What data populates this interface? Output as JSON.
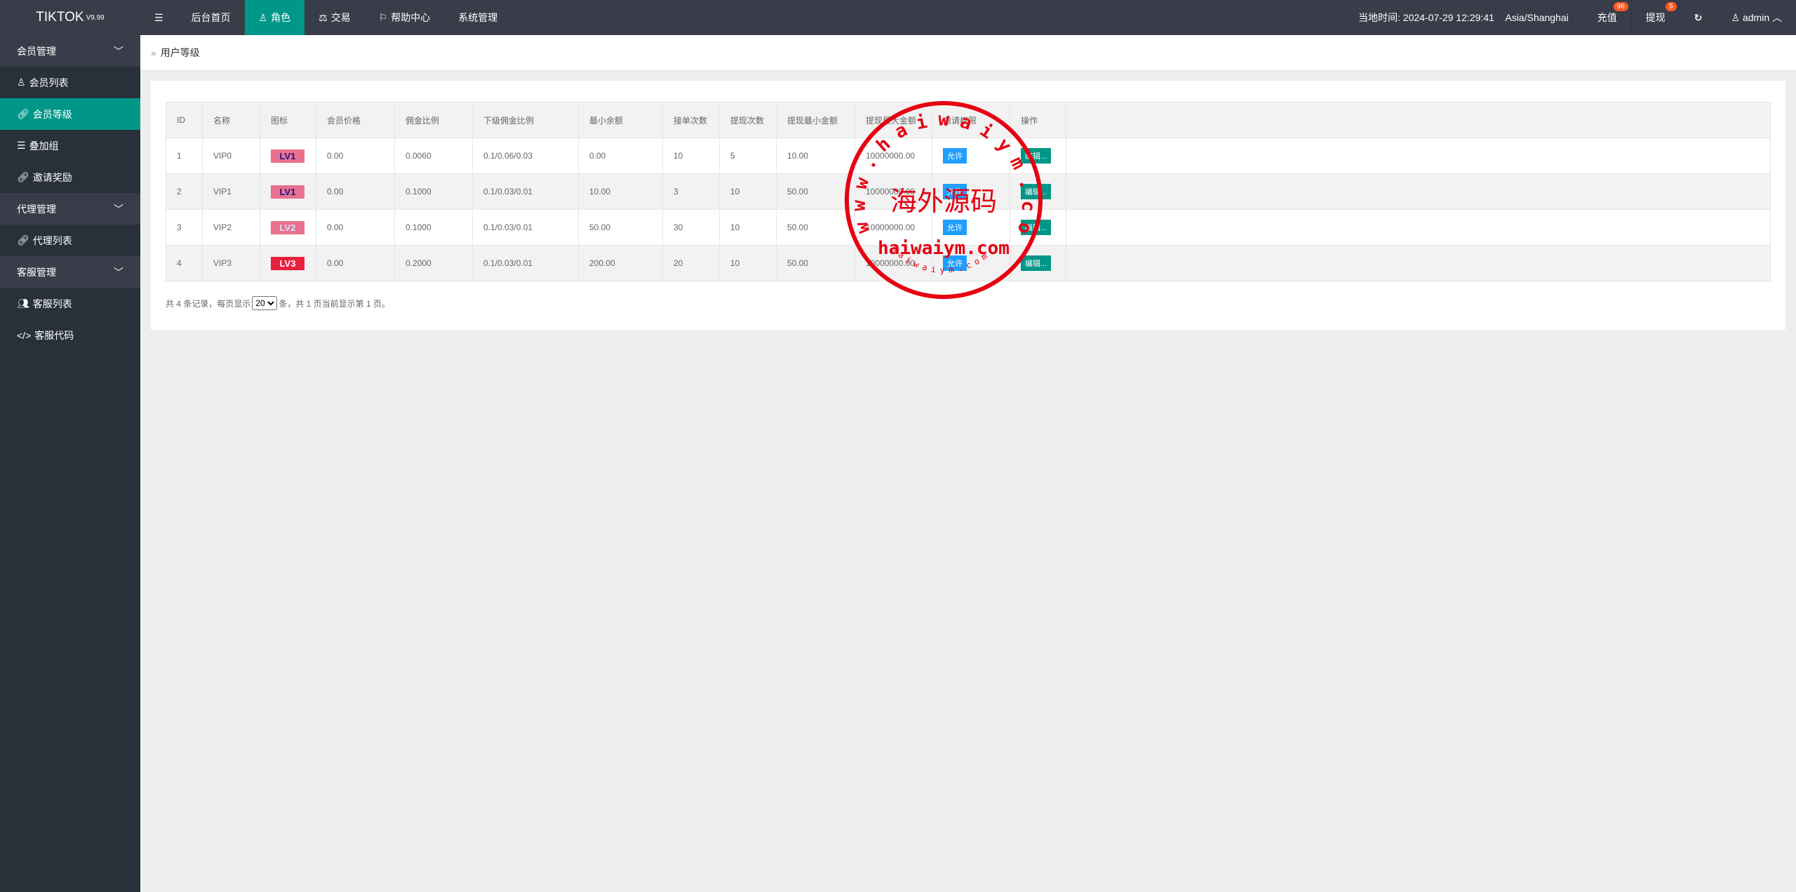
{
  "header": {
    "logo": "TIKTOK",
    "version": "V9.99",
    "nav": [
      {
        "label": "后台首页"
      },
      {
        "label": "角色",
        "active": true
      },
      {
        "label": "交易"
      },
      {
        "label": "帮助中心"
      },
      {
        "label": "系统管理"
      }
    ],
    "local_time": "当地时间: 2024-07-29 12:29:41",
    "timezone": "Asia/Shanghai",
    "recharge": "充值",
    "recharge_badge": "96",
    "withdraw": "提现",
    "withdraw_badge": "5",
    "user": "admin"
  },
  "sidebar": {
    "groups": [
      {
        "label": "会员管理",
        "items": [
          {
            "label": "会员列表",
            "icon": "user-icon"
          },
          {
            "label": "会员等级",
            "icon": "link-icon",
            "active": true
          },
          {
            "label": "叠加组",
            "icon": "list-icon"
          },
          {
            "label": "邀请奖励",
            "icon": "link-icon"
          }
        ]
      },
      {
        "label": "代理管理",
        "items": [
          {
            "label": "代理列表",
            "icon": "link-icon"
          }
        ]
      },
      {
        "label": "客服管理",
        "items": [
          {
            "label": "客服列表",
            "icon": "users-icon"
          },
          {
            "label": "客服代码",
            "icon": "code-icon"
          }
        ]
      }
    ]
  },
  "breadcrumb": "用户等级",
  "table": {
    "columns": [
      "ID",
      "名称",
      "图标",
      "会员价格",
      "佣金比例",
      "下级佣金比例",
      "最小余额",
      "接单次数",
      "提现次数",
      "提现最小金额",
      "提现最大金额",
      "邀请权限",
      "操作",
      ""
    ],
    "rows": [
      {
        "id": "1",
        "name": "VIP0",
        "icon": "LV1",
        "icon_color": "#1a1a8c",
        "price": "0.00",
        "commission": "0.0060",
        "sub_commission": "0.1/0.06/0.03",
        "min_balance": "0.00",
        "orders": "10",
        "withdraw_times": "5",
        "withdraw_min": "10.00",
        "withdraw_max": "10000000.00",
        "invite": "允许",
        "action": "编辑..."
      },
      {
        "id": "2",
        "name": "VIP1",
        "icon": "LV1",
        "icon_color": "#1a1a8c",
        "price": "0.00",
        "commission": "0.1000",
        "sub_commission": "0.1/0.03/0.01",
        "min_balance": "10.00",
        "orders": "3",
        "withdraw_times": "10",
        "withdraw_min": "50.00",
        "withdraw_max": "10000000.00",
        "invite": "允许",
        "action": "编辑..."
      },
      {
        "id": "3",
        "name": "VIP2",
        "icon": "LV2",
        "icon_color": "#cfe6ff",
        "price": "0.00",
        "commission": "0.1000",
        "sub_commission": "0.1/0.03/0.01",
        "min_balance": "50.00",
        "orders": "30",
        "withdraw_times": "10",
        "withdraw_min": "50.00",
        "withdraw_max": "10000000.00",
        "invite": "允许",
        "action": "编辑..."
      },
      {
        "id": "4",
        "name": "VIP3",
        "icon": "LV3",
        "icon_color": "#ffffff",
        "price": "0.00",
        "commission": "0.2000",
        "sub_commission": "0.1/0.03/0.01",
        "min_balance": "200.00",
        "orders": "20",
        "withdraw_times": "10",
        "withdraw_min": "50.00",
        "withdraw_max": "10000000.00",
        "invite": "允许",
        "action": "编辑..."
      }
    ]
  },
  "pager": {
    "prefix": "共 4 条记录，每页显示",
    "page_size": "20",
    "suffix": "条，共 1 页当前显示第 1 页。"
  },
  "watermark": {
    "center": "海外源码",
    "domain": "haiwaiym.com",
    "ring": "www.haiwaiym.com",
    "color": "#e60012"
  }
}
